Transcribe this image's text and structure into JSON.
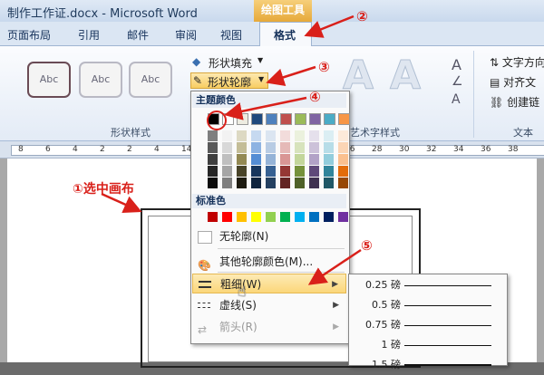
{
  "titlebar": {
    "title": "制作工作证.docx - Microsoft Word",
    "context_tab": "绘图工具"
  },
  "tabs": [
    {
      "label": "页面布局"
    },
    {
      "label": "引用"
    },
    {
      "label": "邮件"
    },
    {
      "label": "审阅"
    },
    {
      "label": "视图"
    },
    {
      "label": "格式"
    }
  ],
  "ribbon": {
    "shape_style_samples": [
      "Abc",
      "Abc",
      "Abc"
    ],
    "shape_fill_label": "形状填充",
    "shape_outline_label": "形状轮廓",
    "group_shape_styles": "形状样式",
    "group_wordart_styles": "艺术字样式",
    "group_text": "文本",
    "text_direction_label": "文字方向",
    "align_text_label": "对齐文",
    "create_link_label": "创建链",
    "wordart_letters": [
      "A",
      "A",
      "A"
    ]
  },
  "ruler": {
    "ticks": [
      "8",
      "6",
      "4",
      "2",
      "2",
      "4",
      "14",
      "16",
      "18",
      "20",
      "22",
      "24",
      "26",
      "28",
      "30",
      "32",
      "34",
      "36",
      "38"
    ]
  },
  "annotations": {
    "step1": "①选中画布",
    "step2": "②",
    "step3": "③",
    "step4": "④",
    "step5": "⑤"
  },
  "dropdown": {
    "theme_colors_label": "主题颜色",
    "standard_colors_label": "标准色",
    "theme_colors_top": [
      "#000000",
      "#ffffff",
      "#eeece1",
      "#1f497d",
      "#4f81bd",
      "#c0504d",
      "#9bbb59",
      "#8064a2",
      "#4bacc6",
      "#f79646"
    ],
    "theme_shade_cols": [
      [
        "#7f7f7f",
        "#595959",
        "#3f3f3f",
        "#262626",
        "#0c0c0c"
      ],
      [
        "#f2f2f2",
        "#d8d8d8",
        "#bfbfbf",
        "#a5a5a5",
        "#7f7f7f"
      ],
      [
        "#ddd9c3",
        "#c4bd97",
        "#938953",
        "#494429",
        "#1d1b10"
      ],
      [
        "#c6d9f0",
        "#8db3e2",
        "#548dd4",
        "#17365d",
        "#0f243e"
      ],
      [
        "#dbe5f1",
        "#b8cce4",
        "#95b3d7",
        "#366092",
        "#244061"
      ],
      [
        "#f2dcdb",
        "#e5b9b7",
        "#d99694",
        "#953734",
        "#632423"
      ],
      [
        "#ebf1dd",
        "#d7e3bc",
        "#c3d69b",
        "#76923c",
        "#4f6128"
      ],
      [
        "#e5e0ec",
        "#ccc1d9",
        "#b2a2c7",
        "#5f497a",
        "#3f3151"
      ],
      [
        "#dbeef3",
        "#b7dde8",
        "#92cddc",
        "#31859b",
        "#205867"
      ],
      [
        "#fdeada",
        "#fbd5b5",
        "#fac08f",
        "#e36c09",
        "#974806"
      ]
    ],
    "standard_colors": [
      "#c00000",
      "#ff0000",
      "#ffc000",
      "#ffff00",
      "#92d050",
      "#00b050",
      "#00b0f0",
      "#0070c0",
      "#002060",
      "#7030a0"
    ],
    "no_outline": "无轮廓(N)",
    "more_colors": "其他轮廓颜色(M)...",
    "weight": "粗细(W)",
    "dashes": "虚线(S)",
    "arrows": "箭头(R)"
  },
  "weight_submenu": [
    {
      "label": "0.25 磅",
      "weight": 0.25
    },
    {
      "label": "0.5 磅",
      "weight": 0.5
    },
    {
      "label": "0.75 磅",
      "weight": 0.75
    },
    {
      "label": "1 磅",
      "weight": 1
    },
    {
      "label": "1.5 磅",
      "weight": 1.5
    }
  ],
  "colors": {
    "annotation": "#d9201a",
    "highlight": "#fbd77a",
    "context_tab": "#e6a93a"
  }
}
